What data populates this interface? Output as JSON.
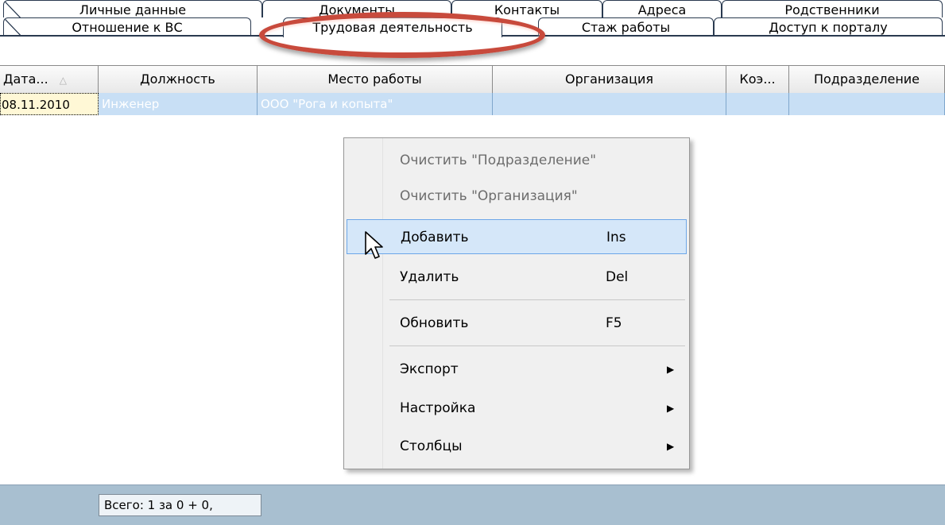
{
  "tabs": {
    "row1": [
      "Личные данные",
      "Документы",
      "Контакты",
      "Адреса",
      "Родственники"
    ],
    "row2": [
      "Отношение к ВС",
      "Трудовая деятельность",
      "Стаж работы",
      "Доступ к порталу"
    ],
    "active": "Трудовая деятельность"
  },
  "grid": {
    "columns": [
      "Дата...",
      "Должность",
      "Место работы",
      "Организация",
      "Коэ...",
      "Подразделение"
    ],
    "sort_indicator": "△",
    "rows": [
      [
        "08.11.2010",
        "Инженер",
        "ООО \"Рога и копыта\"",
        "",
        "",
        ""
      ]
    ]
  },
  "footer": {
    "summary": "Всего: 1 за 0 + 0,"
  },
  "context_menu": {
    "items": [
      {
        "label": "Очистить \"Подразделение\"",
        "shortcut": "",
        "disabled": true
      },
      {
        "label": "Очистить \"Организация\"",
        "shortcut": "",
        "disabled": true
      },
      {
        "label": "Добавить",
        "shortcut": "Ins",
        "hovered": true
      },
      {
        "label": "Удалить",
        "shortcut": "Del"
      },
      {
        "label": "Обновить",
        "shortcut": "F5"
      },
      {
        "label": "Экспорт",
        "submenu": true
      },
      {
        "label": "Настройка",
        "submenu": true
      },
      {
        "label": "Столбцы",
        "submenu": true
      }
    ],
    "submenu_arrow": "▶"
  },
  "colors": {
    "selection_row": "#c8dff5",
    "highlight_ring": "#c84a3c",
    "footer_bg": "#a8bfd0",
    "menu_hover": "#d5e7f9"
  }
}
